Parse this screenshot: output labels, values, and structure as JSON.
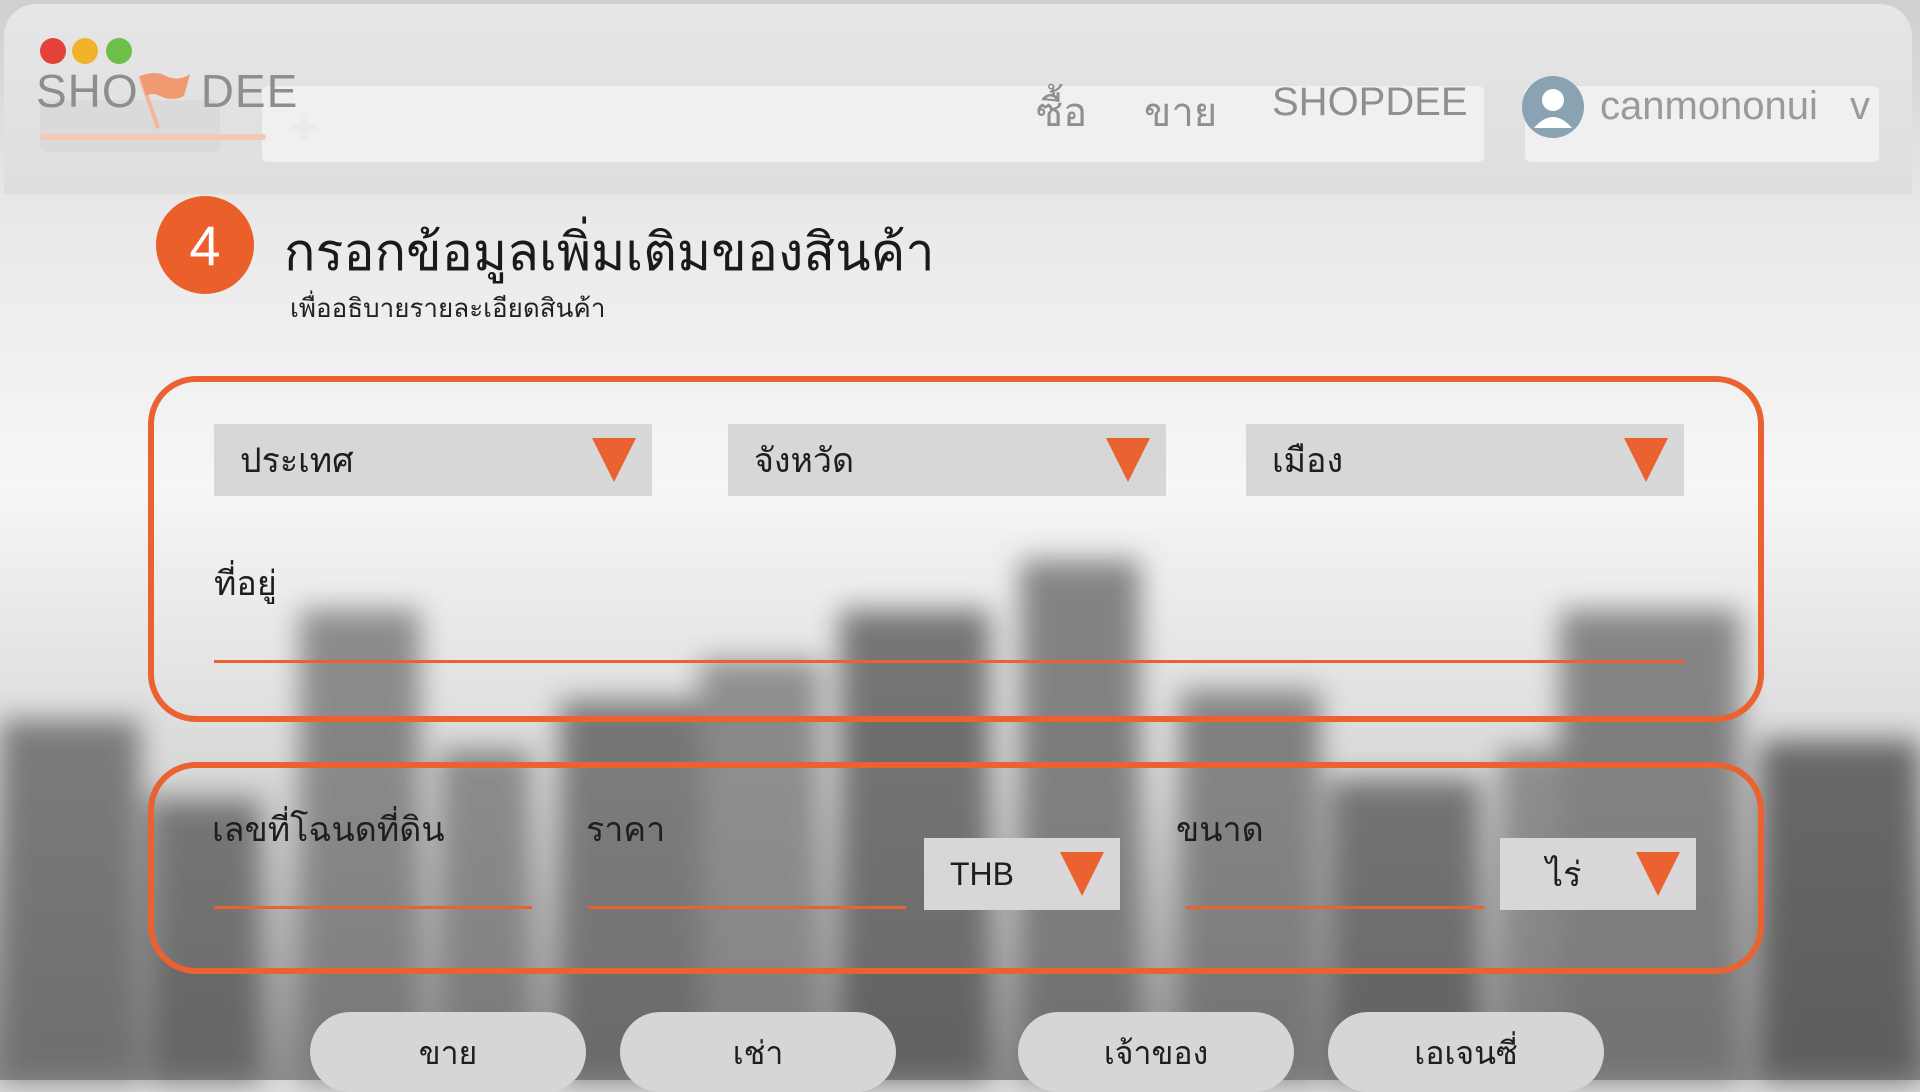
{
  "brand": {
    "logo_left": "SHO",
    "logo_right": "DEE"
  },
  "nav": {
    "buy": "ซื้อ",
    "sell": "ขาย",
    "brand": "SHOPDEE"
  },
  "user": {
    "name": "canmononui",
    "caret": "v"
  },
  "step": {
    "number": "4",
    "title": "กรอกข้อมูลเพิ่มเติมของสินค้า",
    "subtitle": "เพื่ออธิบายรายละเอียดสินค้า"
  },
  "location": {
    "country": "ประเทศ",
    "province": "จังหวัด",
    "city": "เมือง",
    "address_label": "ที่อยู่"
  },
  "details": {
    "deed_label": "เลขที่โฉนดที่ดิน",
    "price_label": "ราคา",
    "currency": "THB",
    "size_label": "ขนาด",
    "size_unit": "ไร่"
  },
  "actions": {
    "sell": "ขาย",
    "rent": "เช่า",
    "owner": "เจ้าของ",
    "agency": "เอเจนซี่"
  },
  "colors": {
    "accent": "#ea6230",
    "field_bg": "#d7d7d7"
  }
}
